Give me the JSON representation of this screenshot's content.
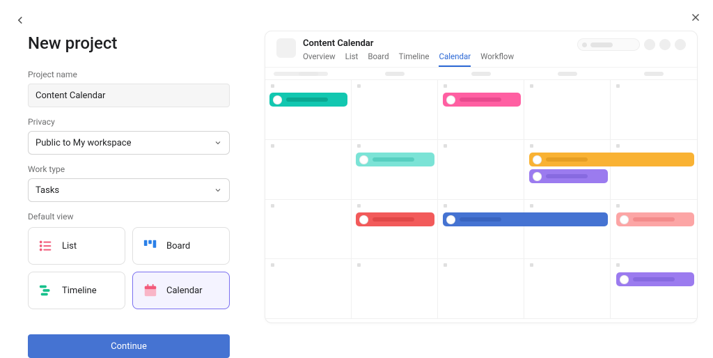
{
  "header": {
    "title": "New project"
  },
  "form": {
    "project_name_label": "Project name",
    "project_name_value": "Content Calendar",
    "privacy_label": "Privacy",
    "privacy_value": "Public to My workspace",
    "work_type_label": "Work type",
    "work_type_value": "Tasks",
    "default_view_label": "Default view",
    "views": {
      "list": "List",
      "board": "Board",
      "timeline": "Timeline",
      "calendar": "Calendar"
    },
    "selected_view": "calendar",
    "continue_label": "Continue"
  },
  "preview": {
    "project_title": "Content Calendar",
    "tabs": {
      "overview": "Overview",
      "list": "List",
      "board": "Board",
      "timeline": "Timeline",
      "calendar": "Calendar",
      "workflow": "Workflow"
    },
    "active_tab": "calendar",
    "events": [
      {
        "row": 0,
        "col_start": 0,
        "col_span": 1,
        "color": "#12c7b0",
        "bar": "#0aa892",
        "avatar": "a"
      },
      {
        "row": 0,
        "col_start": 2,
        "col_span": 1,
        "color": "#ff5fa2",
        "bar": "#e94a8e",
        "avatar": "b"
      },
      {
        "row": 1,
        "col_start": 1,
        "col_span": 1,
        "color": "#7be3d6",
        "bar": "#57cfc0",
        "avatar": "d"
      },
      {
        "row": 1,
        "col_start": 3,
        "col_span": 2,
        "color": "#f9b233",
        "bar": "#e69f24",
        "avatar": "a"
      },
      {
        "row": 1,
        "col_start": 3,
        "col_span": 1,
        "color": "#9b7bef",
        "bar": "#876ae0",
        "avatar": "a",
        "offset": 24
      },
      {
        "row": 2,
        "col_start": 1,
        "col_span": 1,
        "color": "#f25a5a",
        "bar": "#e14848",
        "avatar": "c"
      },
      {
        "row": 2,
        "col_start": 2,
        "col_span": 2,
        "color": "#4573d2",
        "bar": "#3964c0",
        "avatar": "b"
      },
      {
        "row": 2,
        "col_start": 4,
        "col_span": 1,
        "color": "#fca5a5",
        "bar": "#f38b8b",
        "avatar": "d"
      },
      {
        "row": 3,
        "col_start": 4,
        "col_span": 1,
        "color": "#9b7bef",
        "bar": "#876ae0",
        "avatar": "c"
      }
    ],
    "colors": {
      "accent": "#4573d2"
    }
  }
}
